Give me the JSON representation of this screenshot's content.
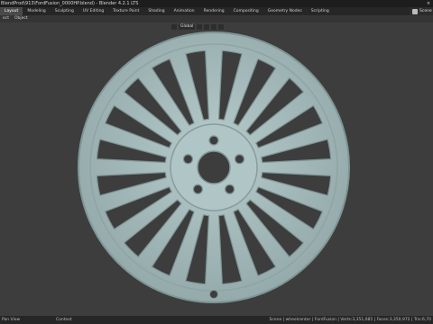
{
  "window": {
    "title": "BlendProd\\913\\FordFusion_0000HP.blend) - Blender 4.2.1 LTS",
    "close_glyph": "×"
  },
  "workspace_tabs": [
    {
      "label": "Layout",
      "active": true
    },
    {
      "label": "Modeling",
      "active": false
    },
    {
      "label": "Sculpting",
      "active": false
    },
    {
      "label": "UV Editing",
      "active": false
    },
    {
      "label": "Texture Paint",
      "active": false
    },
    {
      "label": "Shading",
      "active": false
    },
    {
      "label": "Animation",
      "active": false
    },
    {
      "label": "Rendering",
      "active": false
    },
    {
      "label": "Compositing",
      "active": false
    },
    {
      "label": "Geometry Nodes",
      "active": false
    },
    {
      "label": "Scripting",
      "active": false
    }
  ],
  "scene_selector": {
    "label": "Scene",
    "icon": "scene-icon"
  },
  "viewport_header": {
    "menus": [
      "ect",
      "Object"
    ],
    "transform_orientation": "Global"
  },
  "viewport": {
    "background": "#3d3d3d",
    "wheel_color": "#a9bebe",
    "wheel_shadow": "#7e9394"
  },
  "status_bar": {
    "left": "Pan View",
    "center": "Context",
    "right": "Scene | wheelcenter  |  FordFusion  |  Verts:3,351,085  |  Faces:3,350,972  |  Tris:6,70"
  }
}
